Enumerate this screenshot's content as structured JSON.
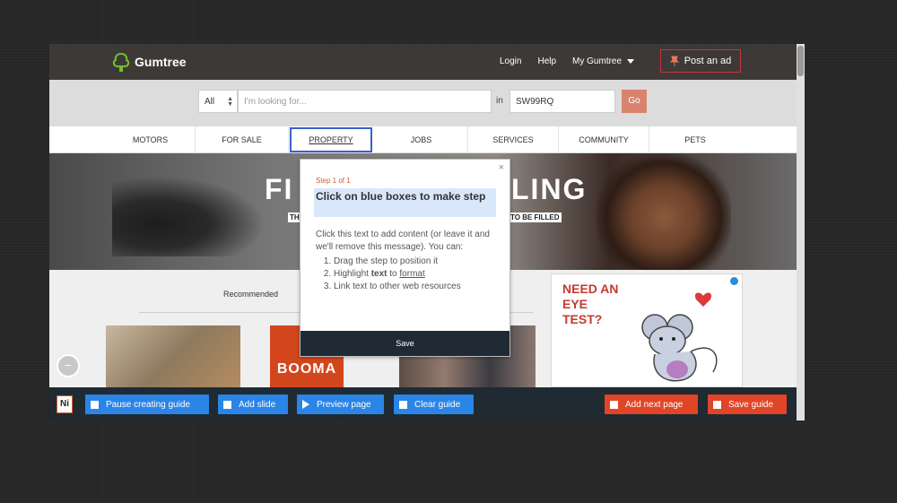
{
  "header": {
    "logo_text": "Gumtree",
    "links": [
      "Login",
      "Help",
      "My Gumtree"
    ],
    "post_ad": "Post an ad"
  },
  "search": {
    "category": "All",
    "placeholder": "I'm looking for...",
    "in_label": "in",
    "location": "SW99RQ",
    "go_label": "Go"
  },
  "categories": [
    {
      "label": "MOTORS"
    },
    {
      "label": "FOR SALE"
    },
    {
      "label": "PROPERTY"
    },
    {
      "label": "JOBS"
    },
    {
      "label": "SERVICES"
    },
    {
      "label": "COMMUNITY"
    },
    {
      "label": "PETS"
    }
  ],
  "hero": {
    "headline_left": "FI",
    "headline_right": "LING",
    "sub_left": "TH",
    "sub_right": "TO BE FILLED"
  },
  "content": {
    "recommended": "Recommended",
    "tile_text": "BOOMA",
    "ad_text": "NEED AN EYE TEST?"
  },
  "popup": {
    "step": "Step 1 of 1",
    "title": "Click on blue boxes to make step",
    "intro": "Click this text to add content (or leave it and we'll remove this message). You can:",
    "item1": "Drag the step to position it",
    "item2_a": "Highlight ",
    "item2_b": "text",
    "item2_c": " to ",
    "item2_d": "format",
    "item3": "Link text to other web resources",
    "save": "Save",
    "close": "×"
  },
  "guidebar": {
    "logo": "Ni",
    "pause": "Pause creating guide",
    "add_slide": "Add slide",
    "preview": "Preview page",
    "clear": "Clear guide",
    "add_next": "Add next page",
    "save_guide": "Save guide"
  },
  "colors": {
    "accent_blue": "#2b85e6",
    "accent_red": "#e14527",
    "topbar": "#3d3937"
  }
}
